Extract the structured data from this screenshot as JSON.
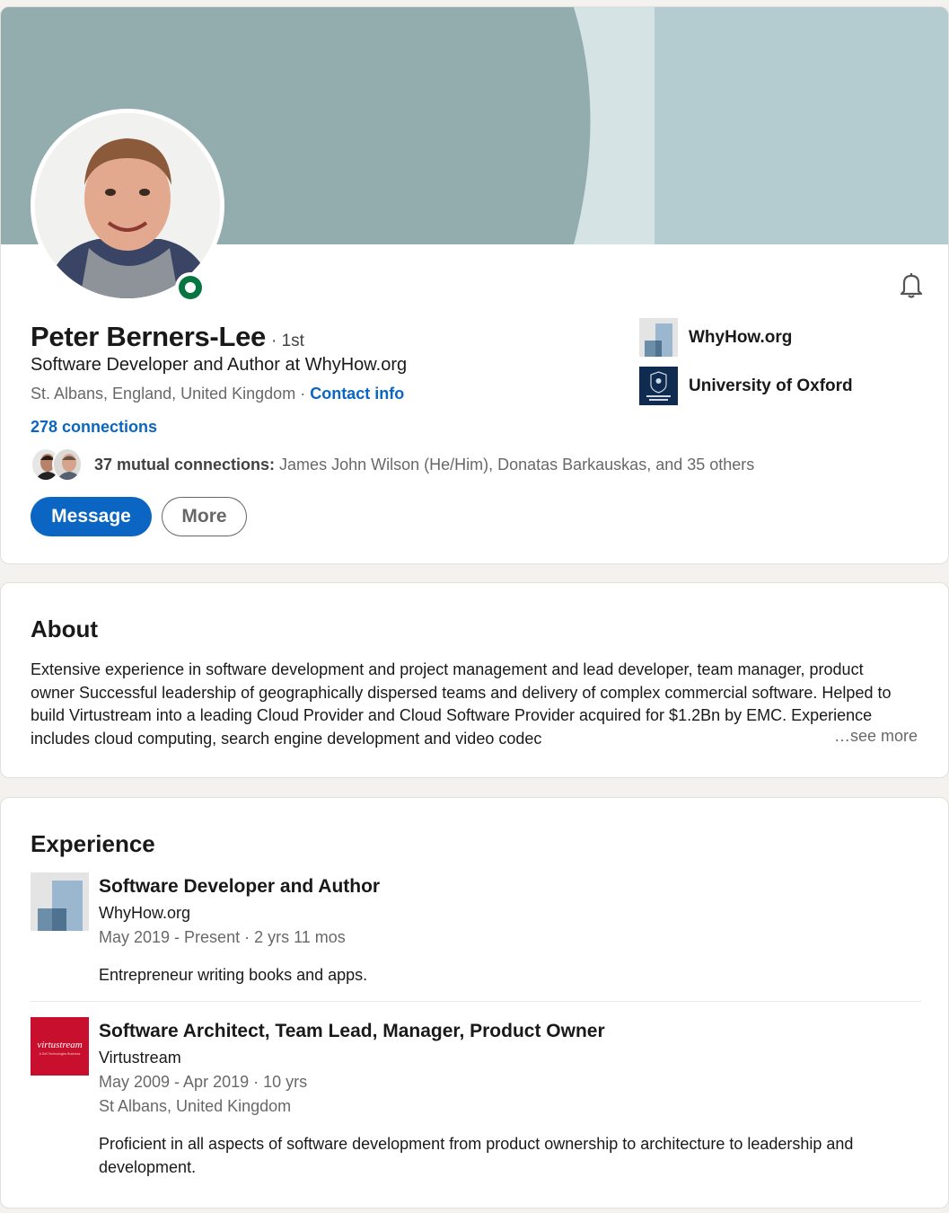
{
  "profile": {
    "name": "Peter Berners-Lee",
    "degree": "· 1st",
    "headline": "Software Developer and Author at WhyHow.org",
    "location": "St. Albans, England, United Kingdom",
    "location_sep": " · ",
    "contact_info": "Contact info",
    "connections": "278 connections",
    "mutual_bold": "37 mutual connections:",
    "mutual_rest": " James John Wilson (He/Him), Donatas Barkauskas, and 35 others",
    "online_status_color": "#057642"
  },
  "actions": {
    "message": "Message",
    "more": "More"
  },
  "side_entities": [
    {
      "label": "WhyHow.org",
      "icon": "whyhow-logo"
    },
    {
      "label": "University of Oxford",
      "icon": "oxford-crest-logo"
    }
  ],
  "about": {
    "title": "About",
    "text": "Extensive experience in software development and project management and lead developer, team manager, product owner Successful leadership of geographically dispersed teams and delivery of complex commercial software. Helped to build Virtustream into a leading Cloud Provider and Cloud Software Provider acquired for $1.2Bn by EMC. Experience includes cloud computing, search engine development and video codec",
    "see_more": "…see more"
  },
  "experience": {
    "title": "Experience",
    "items": [
      {
        "title": "Software Developer and Author",
        "company": "WhyHow.org",
        "dates": "May 2019 - Present · 2 yrs 11 mos",
        "location": "",
        "description": "Entrepreneur writing books and apps."
      },
      {
        "title": "Software Architect, Team Lead, Manager, Product Owner",
        "company": "Virtustream",
        "dates": "May 2009 - Apr 2019 · 10 yrs",
        "location": "St Albans, United Kingdom",
        "description": "Proficient in all aspects of software development from product ownership to architecture to leadership and development."
      }
    ]
  },
  "colors": {
    "brand_blue": "#0a66c2",
    "virtustream_red": "#c8102e",
    "oxford_navy": "#0f2b4f"
  }
}
